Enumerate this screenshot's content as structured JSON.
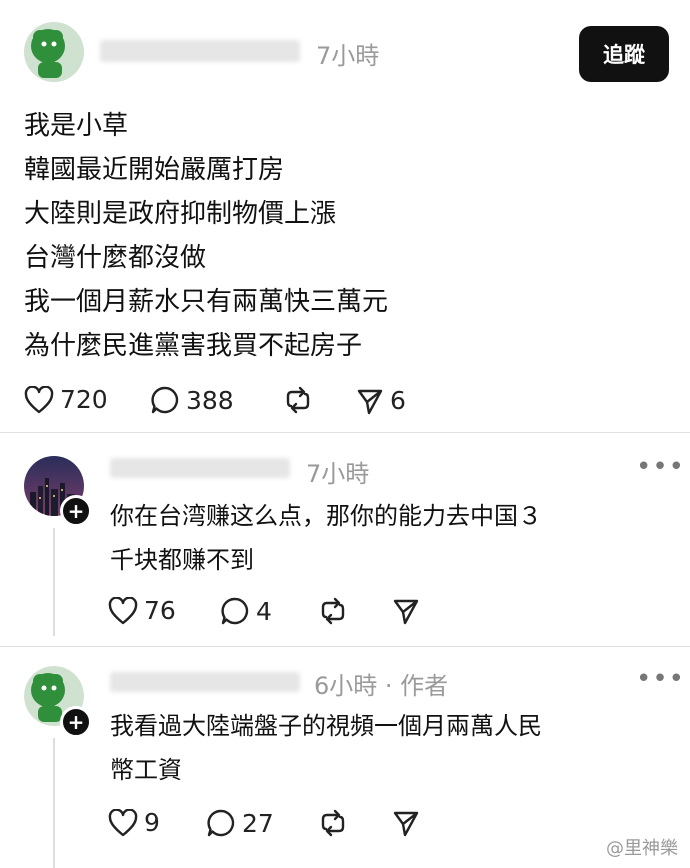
{
  "post": {
    "time": "7小時",
    "follow_label": "追蹤",
    "lines": [
      "我是小草",
      "韓國最近開始嚴厲打房",
      "大陸則是政府抑制物價上漲",
      "台灣什麼都沒做",
      "我一個月薪水只有兩萬快三萬元",
      "為什麼民進黨害我買不起房子"
    ],
    "likes": "720",
    "comments": "388",
    "shares": "6"
  },
  "replies": [
    {
      "time": "7小時",
      "lines": [
        "你在台湾赚这么点，那你的能力去中国３",
        "千块都赚不到"
      ],
      "likes": "76",
      "comments": "4"
    },
    {
      "time": "6小時 · 作者",
      "lines": [
        "我看過大陸端盤子的視頻一個月兩萬人民",
        "幣工資"
      ],
      "likes": "9",
      "comments": "27"
    }
  ],
  "watermark": "@里神樂",
  "icons": {
    "like": "heart-icon",
    "comment": "comment-bubble-icon",
    "repost": "repost-icon",
    "share": "send-icon",
    "more": "more-dots-icon"
  }
}
